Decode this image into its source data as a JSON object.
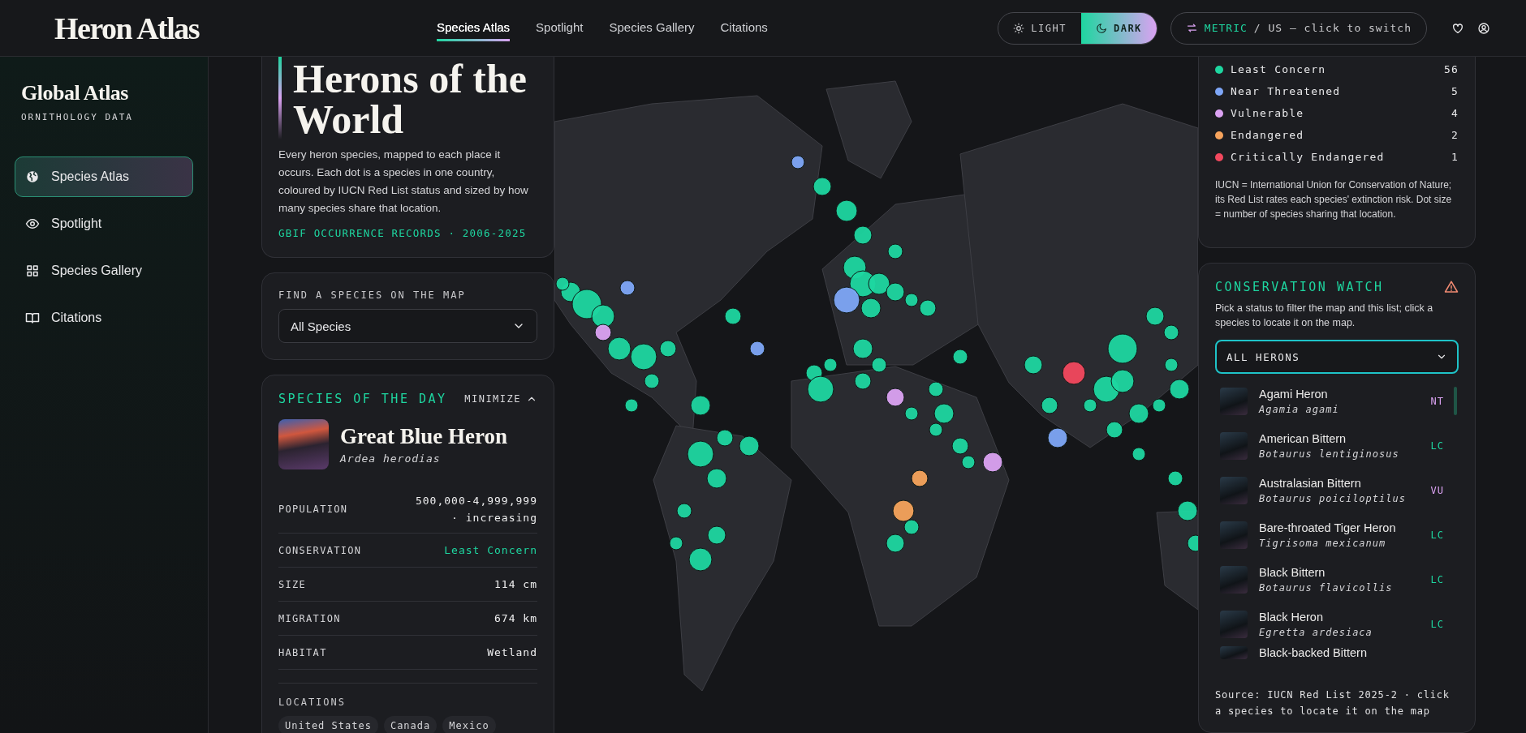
{
  "header": {
    "logo": "Heron Atlas",
    "nav": [
      {
        "label": "Species Atlas",
        "selected": true
      },
      {
        "label": "Spotlight",
        "selected": false
      },
      {
        "label": "Species Gallery",
        "selected": false
      },
      {
        "label": "Citations",
        "selected": false
      }
    ],
    "theme_toggle": [
      {
        "label": "LIGHT",
        "selected": false
      },
      {
        "label": "DARK",
        "selected": true
      }
    ],
    "units": {
      "active": "METRIC",
      "rest": "/ US — click to switch"
    }
  },
  "sidebar": {
    "title": "Global Atlas",
    "subtitle": "ORNITHOLOGY DATA",
    "items": [
      {
        "label": "Species Atlas",
        "selected": true
      },
      {
        "label": "Spotlight",
        "selected": false
      },
      {
        "label": "Species Gallery",
        "selected": false
      },
      {
        "label": "Citations",
        "selected": false
      }
    ]
  },
  "intro": {
    "title": "Herons of the World",
    "description": "Every heron species, mapped to each place it occurs. Each dot is a species in one country, coloured by IUCN Red List status and sized by how many species share that location.",
    "source": "GBIF OCCURRENCE RECORDS · 2006-2025"
  },
  "finder": {
    "label": "FIND A SPECIES ON THE MAP",
    "value": "All Species"
  },
  "species_of_day": {
    "heading": "SPECIES OF THE DAY",
    "minimize": "MINIMIZE",
    "name": "Great Blue Heron",
    "scientific_name": "Ardea herodias",
    "facts": [
      {
        "label": "POPULATION",
        "value": "500,000-4,999,999 · increasing",
        "kind": "text"
      },
      {
        "label": "CONSERVATION",
        "value": "Least Concern",
        "kind": "status"
      },
      {
        "label": "SIZE",
        "value": "114 cm",
        "kind": "text"
      },
      {
        "label": "MIGRATION",
        "value": "674 km",
        "kind": "text"
      },
      {
        "label": "HABITAT",
        "value": "Wetland",
        "kind": "text"
      }
    ],
    "locations_label": "LOCATIONS",
    "locations": [
      "United States",
      "Canada",
      "Mexico"
    ]
  },
  "legend": {
    "items": [
      {
        "label": "Least Concern",
        "count": "56",
        "color": "#1ed6a0"
      },
      {
        "label": "Near Threatened",
        "count": "5",
        "color": "#7ea6f7"
      },
      {
        "label": "Vulnerable",
        "count": "4",
        "color": "#dba2f2"
      },
      {
        "label": "Endangered",
        "count": "2",
        "color": "#f6a35c"
      },
      {
        "label": "Critically Endangered",
        "count": "1",
        "color": "#f2485e"
      }
    ],
    "note": "IUCN = International Union for Conservation of Nature; its Red List rates each species' extinction risk. Dot size = number of species sharing that location."
  },
  "conservation_watch": {
    "title": "CONSERVATION WATCH",
    "description": "Pick a status to filter the map and this list; click a species to locate it on the map.",
    "filter": "ALL HERONS",
    "species": [
      {
        "name": "Agami Heron",
        "scientific_name": "Agamia agami",
        "status": "NT",
        "color": "#dba2f2"
      },
      {
        "name": "American Bittern",
        "scientific_name": "Botaurus lentiginosus",
        "status": "LC",
        "color": "#1ed6a0"
      },
      {
        "name": "Australasian Bittern",
        "scientific_name": "Botaurus poiciloptilus",
        "status": "VU",
        "color": "#dba2f2"
      },
      {
        "name": "Bare-throated Tiger Heron",
        "scientific_name": "Tigrisoma mexicanum",
        "status": "LC",
        "color": "#1ed6a0"
      },
      {
        "name": "Black Bittern",
        "scientific_name": "Botaurus flavicollis",
        "status": "LC",
        "color": "#1ed6a0"
      },
      {
        "name": "Black Heron",
        "scientific_name": "Egretta ardesiaca",
        "status": "LC",
        "color": "#1ed6a0"
      },
      {
        "name": "Black-backed Bittern"
      }
    ],
    "source": "Source: IUCN Red List 2025-2 · click a species to locate it on the map"
  }
}
